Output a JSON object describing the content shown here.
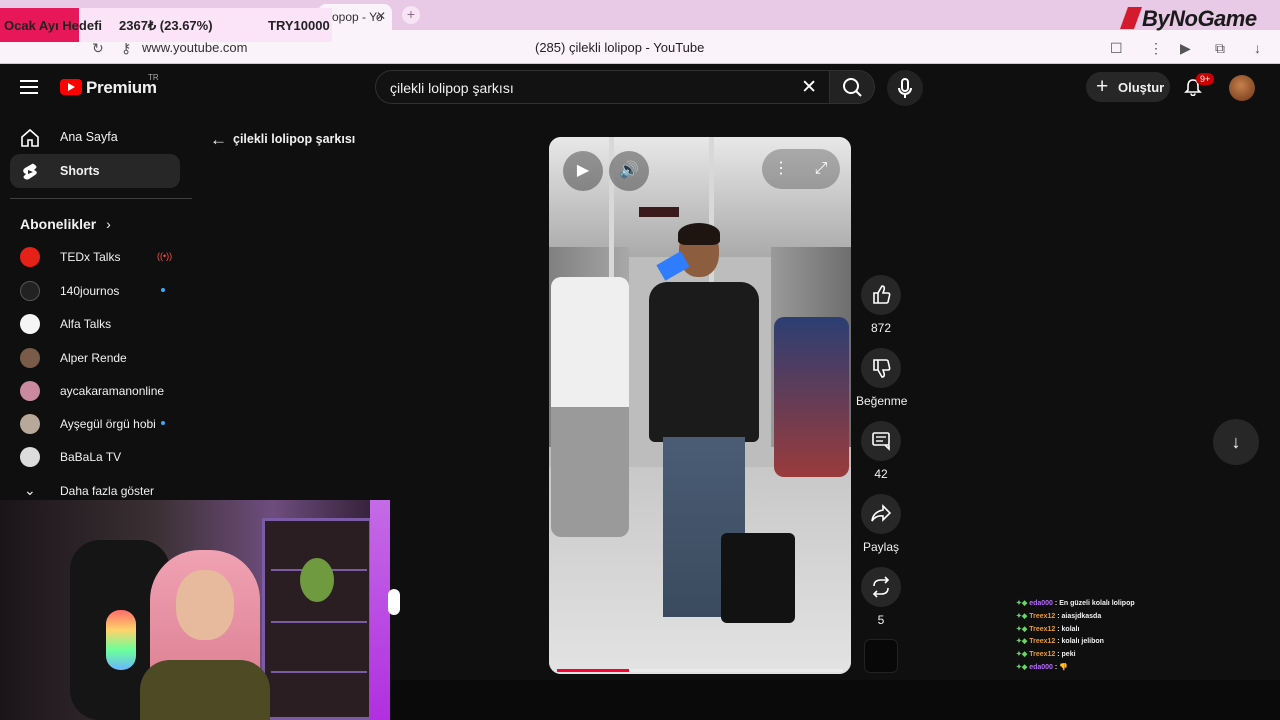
{
  "browser": {
    "tab_title": "opop - Yo",
    "url": "www.youtube.com",
    "page_title": "(285) çilekli lolipop - YouTube"
  },
  "stream_overlay": {
    "goal_label": "Ocak Ayı Hedefi",
    "goal_amount": "2367₺ (23.67%)",
    "goal_progress_percent": 23.67,
    "goal_target": "TRY10000",
    "brand": "ByNoGame"
  },
  "youtube": {
    "logo_text": "Premium",
    "region": "TR",
    "search_value": "çilekli lolipop şarkısı",
    "create_label": "Oluştur",
    "notif_badge": "9+"
  },
  "sidebar": {
    "items": [
      {
        "label": "Ana Sayfa",
        "icon": "home-icon"
      },
      {
        "label": "Shorts",
        "icon": "shorts-icon",
        "active": true
      }
    ],
    "subs_header": "Abonelikler",
    "subscriptions": [
      {
        "name": "TEDx Talks",
        "status": "live",
        "color": "#e62117"
      },
      {
        "name": "140journos",
        "status": "new",
        "color": "#222222"
      },
      {
        "name": "Alfa Talks",
        "status": "",
        "color": "#f5f5f5"
      },
      {
        "name": "Alper Rende",
        "status": "",
        "color": "#7a5a48"
      },
      {
        "name": "aycakaramanonline",
        "status": "",
        "color": "#c98aa0"
      },
      {
        "name": "Ayşegül örgü hobi",
        "status": "new",
        "color": "#b8a89a"
      },
      {
        "name": "BaBaLa TV",
        "status": "",
        "color": "#dcdcdc"
      }
    ],
    "show_more": "Daha fazla göster"
  },
  "shorts": {
    "back_label": "çilekli lolipop şarkısı",
    "likes": "872",
    "dislike_label": "Beğenme",
    "comments": "42",
    "share_label": "Paylaş",
    "remix_count": "5",
    "progress_fraction": 0.25
  },
  "chat": [
    {
      "user": "eda000",
      "message": "En güzeli kolalı lolipop",
      "user_color": "#b46dff"
    },
    {
      "user": "Treex12",
      "message": "aiasjdkasda",
      "user_color": "#e89b3b"
    },
    {
      "user": "Treex12",
      "message": "kolalı",
      "user_color": "#e89b3b"
    },
    {
      "user": "Treex12",
      "message": "kolalı jelibon",
      "user_color": "#e89b3b"
    },
    {
      "user": "Treex12",
      "message": "peki",
      "user_color": "#e89b3b"
    },
    {
      "user": "eda000",
      "message": "👎",
      "user_color": "#b46dff"
    }
  ]
}
